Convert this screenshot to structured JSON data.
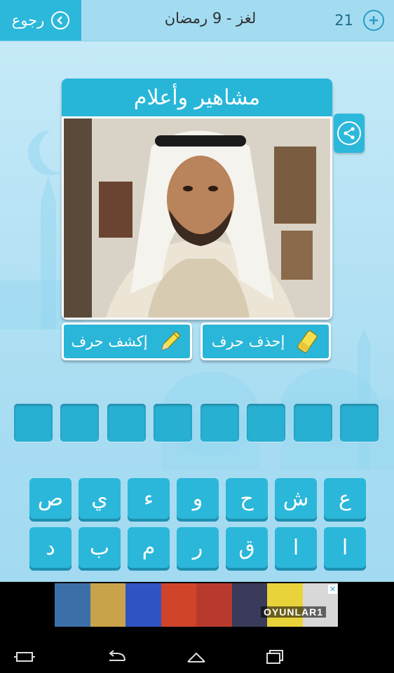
{
  "header": {
    "back_label": "رجوع",
    "level_title": "لغز - 9 رمضان",
    "coins": "21"
  },
  "card": {
    "category": "مشاهير وأعلام"
  },
  "hints": {
    "remove_letter": "إحذف حرف",
    "reveal_letter": "إكشف حرف"
  },
  "answer_slots": 8,
  "keyboard": {
    "row1": [
      "ع",
      "ش",
      "ح",
      "و",
      "ء",
      "ي",
      "ص"
    ],
    "row2": [
      "ا",
      "ا",
      "ق",
      "ر",
      "م",
      "ب",
      "د"
    ]
  },
  "ad": {
    "brand": "OYUNLAR1"
  },
  "colors": {
    "accent": "#2cb8da",
    "background": "#b5e3f5"
  },
  "icons": {
    "back": "back-chevron-icon",
    "add_coins": "plus-circle-icon",
    "share": "share-icon",
    "remove": "eraser-icon",
    "reveal": "pencil-icon"
  }
}
